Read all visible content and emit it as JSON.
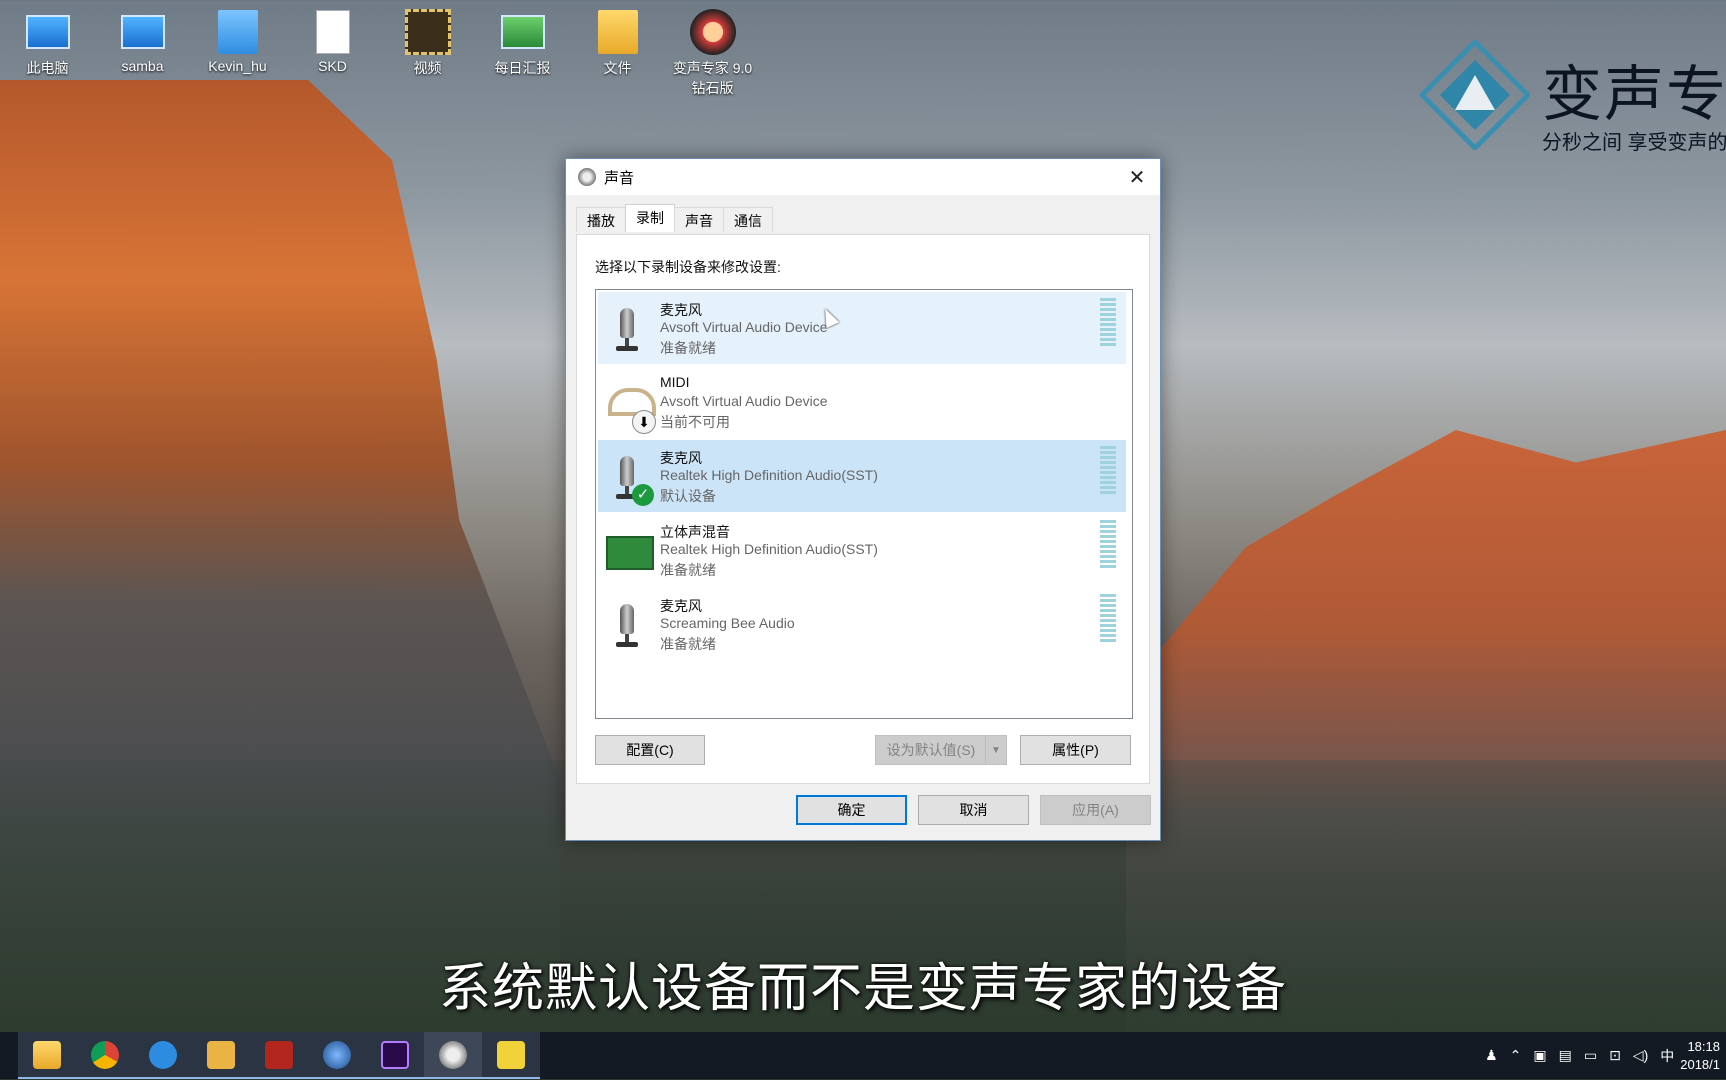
{
  "desktop": {
    "icons": [
      {
        "label": "此电脑",
        "icon": "computer-icon"
      },
      {
        "label": "samba",
        "icon": "network-computer-icon"
      },
      {
        "label": "Kevin_hu",
        "icon": "folder-icon"
      },
      {
        "label": "SKD",
        "icon": "document-icon"
      },
      {
        "label": "视频",
        "icon": "video-folder-icon"
      },
      {
        "label": "每日汇报",
        "icon": "network-drive-icon"
      },
      {
        "label": "文件",
        "icon": "folder-icon"
      },
      {
        "label": "变声专家 9.0\n钻石版",
        "icon": "voice-changer-app-icon"
      }
    ]
  },
  "brand": {
    "title": "变声专",
    "subtitle": "分秒之间 享受变声的"
  },
  "dialog": {
    "title": "声音",
    "tabs": [
      "播放",
      "录制",
      "声音",
      "通信"
    ],
    "active_tab": "录制",
    "instruction": "选择以下录制设备来修改设置:",
    "devices": [
      {
        "name": "麦克风",
        "driver": "Avsoft Virtual Audio Device",
        "status": "准备就绪",
        "icon": "microphone-icon",
        "badge": ""
      },
      {
        "name": "MIDI",
        "driver": "Avsoft Virtual Audio Device",
        "status": "当前不可用",
        "icon": "midi-cable-icon",
        "badge": "download-arrow-icon"
      },
      {
        "name": "麦克风",
        "driver": "Realtek High Definition Audio(SST)",
        "status": "默认设备",
        "icon": "microphone-icon",
        "badge": "checkmark-icon"
      },
      {
        "name": "立体声混音",
        "driver": "Realtek High Definition Audio(SST)",
        "status": "准备就绪",
        "icon": "sound-card-icon",
        "badge": ""
      },
      {
        "name": "麦克风",
        "driver": "Screaming Bee Audio",
        "status": "准备就绪",
        "icon": "microphone-icon",
        "badge": ""
      }
    ],
    "buttons": {
      "configure": "配置(C)",
      "set_default": "设为默认值(S)",
      "properties": "属性(P)",
      "ok": "确定",
      "cancel": "取消",
      "apply": "应用(A)"
    },
    "close_glyph": "✕"
  },
  "subtitle": "系统默认设备而不是变声专家的设备",
  "taskbar": {
    "apps": [
      "file-explorer-icon",
      "chrome-icon",
      "feather-app-icon",
      "cat-app-icon",
      "red-m-app-icon",
      "globe-app-icon",
      "premiere-pro-icon",
      "sound-settings-icon",
      "media-app-icon"
    ],
    "tray_ime": "中",
    "clock_time": "18:18",
    "clock_date": "2018/1"
  },
  "colors": {
    "accent": "#0078d7",
    "selected_row": "#cce4f7",
    "hover_row": "#e5f1fb",
    "default_badge": "#1b9a3e"
  }
}
